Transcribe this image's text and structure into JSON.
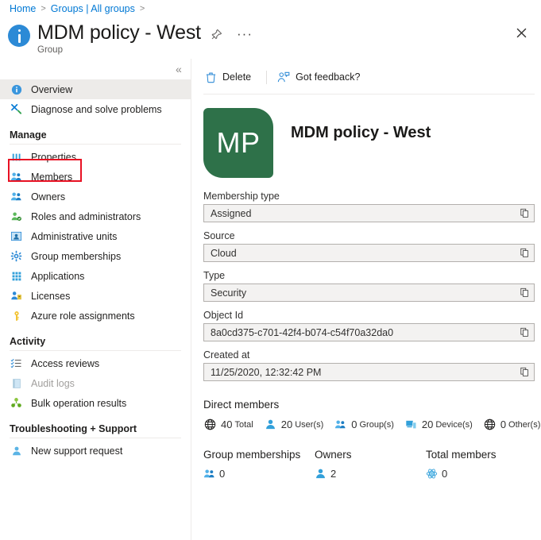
{
  "breadcrumb": {
    "items": [
      "Home",
      "Groups | All groups"
    ],
    "separator": ">"
  },
  "header": {
    "title": "MDM policy - West",
    "subtitle": "Group",
    "pin_icon": "pin-icon",
    "more_icon": "ellipsis-icon",
    "more_label": "···",
    "close_icon": "close-icon",
    "collapse_icon": "double-chevron-left-icon",
    "collapse_glyph": "«",
    "info_icon": "info-icon"
  },
  "sidebar": {
    "items": [
      {
        "label": "Overview",
        "icon": "info-icon",
        "selected": true,
        "disabled": false
      },
      {
        "label": "Diagnose and solve problems",
        "icon": "wrench-icon",
        "selected": false,
        "disabled": false
      }
    ],
    "sections": [
      {
        "title": "Manage",
        "items": [
          {
            "label": "Properties",
            "icon": "properties-icon",
            "highlighted": true,
            "disabled": false
          },
          {
            "label": "Members",
            "icon": "members-icon",
            "highlighted": false,
            "disabled": false
          },
          {
            "label": "Owners",
            "icon": "owners-icon",
            "highlighted": false,
            "disabled": false
          },
          {
            "label": "Roles and administrators",
            "icon": "roles-icon",
            "highlighted": false,
            "disabled": false
          },
          {
            "label": "Administrative units",
            "icon": "admin-units-icon",
            "highlighted": false,
            "disabled": false
          },
          {
            "label": "Group memberships",
            "icon": "group-memberships-icon",
            "highlighted": false,
            "disabled": false
          },
          {
            "label": "Applications",
            "icon": "applications-icon",
            "highlighted": false,
            "disabled": false
          },
          {
            "label": "Licenses",
            "icon": "licenses-icon",
            "highlighted": false,
            "disabled": false
          },
          {
            "label": "Azure role assignments",
            "icon": "key-icon",
            "highlighted": false,
            "disabled": false
          }
        ]
      },
      {
        "title": "Activity",
        "items": [
          {
            "label": "Access reviews",
            "icon": "access-reviews-icon",
            "highlighted": false,
            "disabled": false
          },
          {
            "label": "Audit logs",
            "icon": "audit-logs-icon",
            "highlighted": false,
            "disabled": true
          },
          {
            "label": "Bulk operation results",
            "icon": "bulk-operations-icon",
            "highlighted": false,
            "disabled": false
          }
        ]
      },
      {
        "title": "Troubleshooting + Support",
        "items": [
          {
            "label": "New support request",
            "icon": "support-person-icon",
            "highlighted": false,
            "disabled": false
          }
        ]
      }
    ]
  },
  "toolbar": {
    "delete_label": "Delete",
    "delete_icon": "trash-icon",
    "feedback_label": "Got feedback?",
    "feedback_icon": "feedback-person-icon"
  },
  "group": {
    "initials": "MP",
    "name": "MDM policy - West",
    "avatar_color": "#2e7149"
  },
  "fields": [
    {
      "label": "Membership type",
      "value": "Assigned",
      "copy_icon": "copy-icon"
    },
    {
      "label": "Source",
      "value": "Cloud",
      "copy_icon": "copy-icon"
    },
    {
      "label": "Type",
      "value": "Security",
      "copy_icon": "copy-icon"
    },
    {
      "label": "Object Id",
      "value": "8a0cd375-c701-42f4-b074-c54f70a32da0",
      "copy_icon": "copy-icon"
    },
    {
      "label": "Created at",
      "value": "11/25/2020, 12:32:42 PM",
      "copy_icon": "copy-icon"
    }
  ],
  "direct_members": {
    "title": "Direct members",
    "stats": [
      {
        "icon": "globe-icon",
        "count": "40",
        "label": "Total"
      },
      {
        "icon": "user-icon",
        "count": "20",
        "label": "User(s)"
      },
      {
        "icon": "group-icon",
        "count": "0",
        "label": "Group(s)"
      },
      {
        "icon": "device-icon",
        "count": "20",
        "label": "Device(s)"
      },
      {
        "icon": "globe-icon",
        "count": "0",
        "label": "Other(s)"
      }
    ]
  },
  "summary_columns": [
    {
      "title": "Group memberships",
      "icon": "group-icon",
      "count": "0"
    },
    {
      "title": "Owners",
      "icon": "user-icon",
      "count": "2"
    },
    {
      "title": "Total members",
      "icon": "atom-icon",
      "count": "0"
    }
  ],
  "colors": {
    "accent": "#0078d4",
    "highlight_box": "#e81123",
    "avatar_green": "#2e7149"
  }
}
